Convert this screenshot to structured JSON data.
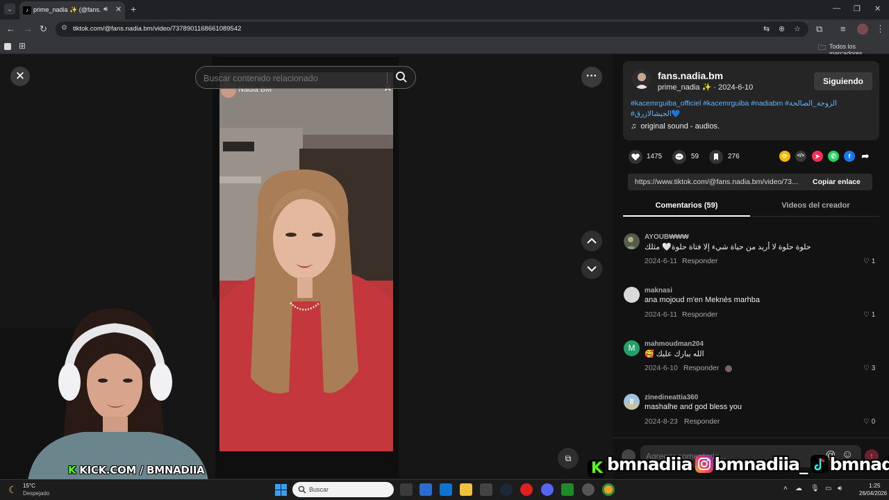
{
  "browser": {
    "tab_title": "prime_nadia ✨ (@fans.nadia",
    "url": "tiktok.com/@fans.nadia.bm/video/7378901168661089542",
    "bookmarks_folder": "Todos los marcadores"
  },
  "player": {
    "search_placeholder": "Buscar contenido relacionado",
    "video_creator_name": "Nadia BM"
  },
  "creator": {
    "handle": "fans.nadia.bm",
    "display_name": "prime_nadia ✨",
    "separator": "·",
    "date": "2024-6-10",
    "follow_label": "Siguiendo",
    "caption_line1": "#kacemrguiba_officiel #kacemrguiba #nadiabm #الزوجة_الصالحة",
    "caption_line2": "#الجيشالازرق💙",
    "music": "original sound - audios."
  },
  "actions": {
    "likes": "1475",
    "comments": "59",
    "saves": "276"
  },
  "share": {
    "link": "https://www.tiktok.com/@fans.nadia.bm/video/73...",
    "copy_label": "Copiar enlace"
  },
  "tabs": {
    "comments": "Comentarios (59)",
    "creator_videos": "Videos del creador"
  },
  "comments": [
    {
      "user": "AYOUB₩₩₩",
      "text": "حلوة حلوة لا أريد من حياة شيء إلا فتاة حلوة🤍 مثلك",
      "date": "2024-6-11",
      "reply": "Responder",
      "likes": "1"
    },
    {
      "user": "maknasi",
      "text": "ana mojoud m'en Meknès marhba",
      "date": "2024-6-11",
      "reply": "Responder",
      "likes": "1"
    },
    {
      "user": "mahmoudman204",
      "avatar_letter": "M",
      "text": "الله يبارك عليك 🥰",
      "date": "2024-6-10",
      "reply": "Responder",
      "likes": "3"
    },
    {
      "user": "zinedineattia360",
      "text": "mashalhe and god bless you",
      "date": "2024-8-23",
      "reply": "Responder",
      "likes": "0"
    }
  ],
  "comment_input_placeholder": "Agregar comentario...",
  "overlay": {
    "kick_k": "K",
    "kick_text": "KICK.COM / BMNADIIA",
    "kick_handle": "bmnadiia",
    "ig_handle": "bmnadiia_",
    "tt_handle": "bmnadiia"
  },
  "taskbar": {
    "temp": "15°C",
    "weather": "Despejado",
    "search_label": "Buscar",
    "time": "1:25",
    "date": "26/04/2026"
  },
  "colors": {
    "tiktok_accent": "#fe2c55",
    "hashtag_blue": "#62b5ff",
    "kick_green": "#53fc18"
  }
}
